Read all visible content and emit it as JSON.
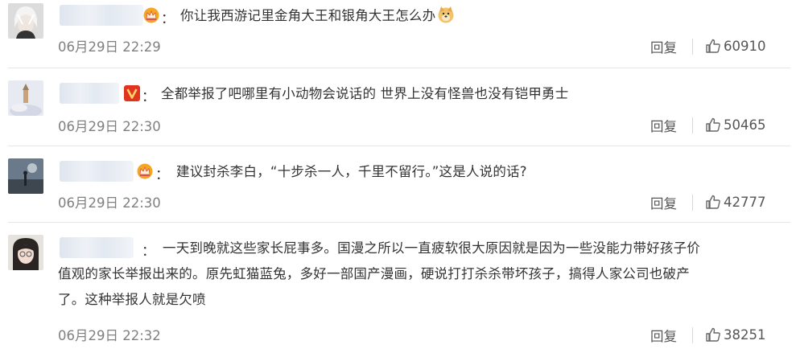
{
  "reply_label": "回复",
  "comments": [
    {
      "text": "你让我西游记里金角大王和银角大王怎么办",
      "time": "06月29日 22:29",
      "likes": "60910",
      "badge": "crown-badge",
      "trailing_emoji": "doge-emoji"
    },
    {
      "text": "全都举报了吧哪里有小动物会说话的 世界上没有怪兽也没有铠甲勇士",
      "time": "06月29日 22:30",
      "likes": "50465",
      "badge": "v-badge"
    },
    {
      "text": "建议封杀李白，“十步杀一人，千里不留行。”这是人说的话?",
      "time": "06月29日 22:30",
      "likes": "42777",
      "badge": "crown-badge"
    },
    {
      "text_lines": [
        "一天到晚就这些家长屁事多。国漫之所以一直疲软很大原因就是因为一些没能力带好孩子价",
        "值观的家长举报出来的。原先虹猫蓝兔，多好一部国产漫画，硬说打打杀杀带坏孩子，搞得人家公司也破产",
        "了。这种举报人就是欠喷"
      ],
      "time": "06月29日 22:32",
      "likes": "38251"
    }
  ],
  "colon": "：",
  "colors": {
    "text": "#333333",
    "meta": "#808080",
    "badge_gold": "#f5a623",
    "badge_red": "#e0341e"
  }
}
